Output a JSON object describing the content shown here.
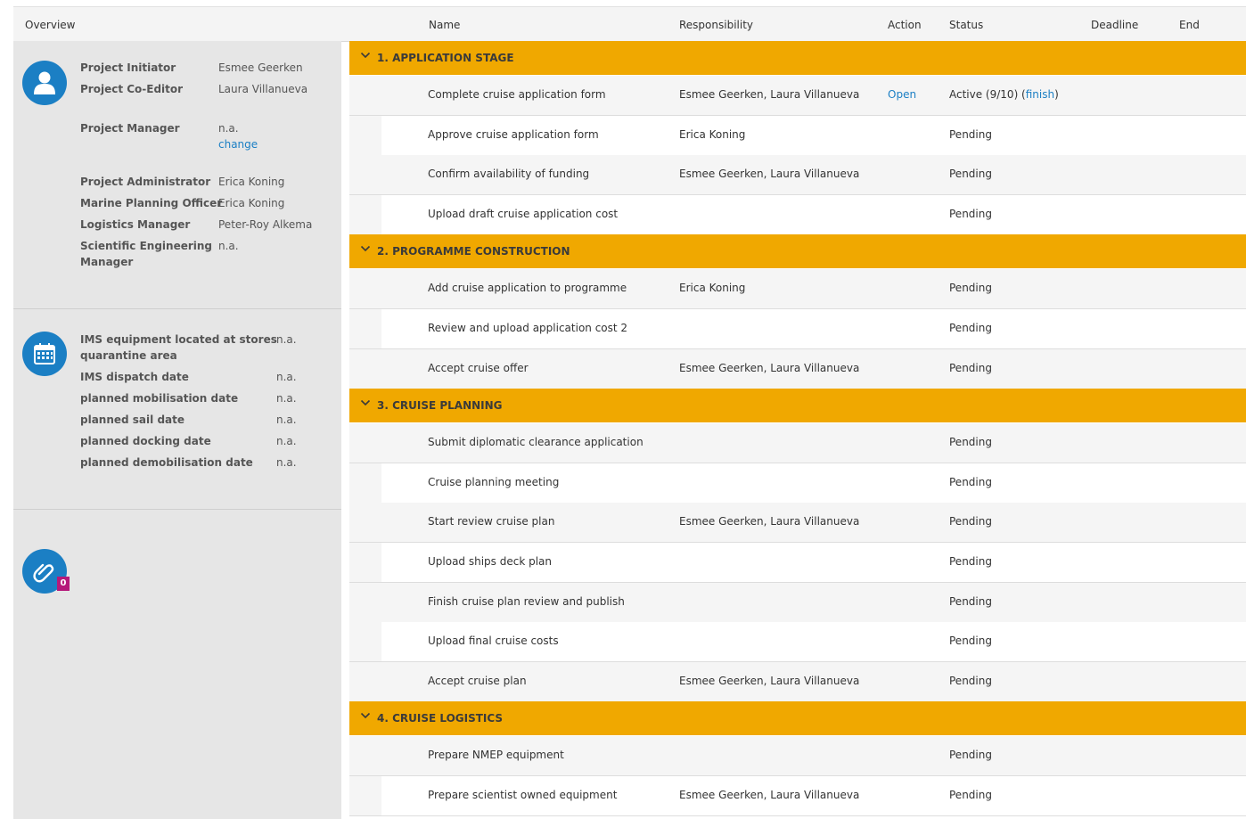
{
  "header": {
    "overview": "Overview",
    "columns": {
      "name": "Name",
      "responsibility": "Responsibility",
      "action": "Action",
      "status": "Status",
      "deadline": "Deadline",
      "end": "End"
    }
  },
  "roles": [
    {
      "label": "Project Initiator",
      "value": "Esmee Geerken"
    },
    {
      "label": "Project Co-Editor",
      "value": "Laura Villanueva"
    },
    {
      "label": "Project Manager",
      "value": "n.a.",
      "link": "change"
    },
    {
      "label": "Project Administrator",
      "value": "Erica Koning"
    },
    {
      "label": "Marine Planning Officer",
      "value": "Erica Koning"
    },
    {
      "label": "Logistics Manager",
      "value": "Peter-Roy Alkema"
    },
    {
      "label": "Scientific Engineering",
      "label2": "Manager",
      "value": "n.a."
    }
  ],
  "dates": [
    {
      "label": "IMS equipment located at stores",
      "label2": "quarantine area",
      "value": "n.a."
    },
    {
      "label": "IMS dispatch date",
      "value": "n.a."
    },
    {
      "label": "planned mobilisation date",
      "value": "n.a."
    },
    {
      "label": "planned sail date",
      "value": "n.a."
    },
    {
      "label": "planned docking date",
      "value": "n.a."
    },
    {
      "label": "planned demobilisation date",
      "value": "n.a."
    }
  ],
  "attachments": {
    "count": "0"
  },
  "icons": {
    "user": "user-icon",
    "calendar": "calendar-icon",
    "attachment": "paperclip-icon",
    "collapse": "chevron-down-icon"
  },
  "colors": {
    "accent": "#1b7fc4",
    "group": "#f0a800",
    "badge": "#b5197a"
  },
  "groups": [
    {
      "title": "1. APPLICATION STAGE",
      "tasks": [
        {
          "name": "Complete cruise application form",
          "resp": "Esmee Geerken, Laura Villanueva",
          "action": "Open",
          "status": "Active (9/10) (",
          "status_link": "finish",
          "status_end": ")"
        },
        {
          "name": "Approve cruise application form",
          "resp": "Erica Koning",
          "status": "Pending"
        },
        {
          "name": "Confirm availability of funding",
          "resp": "Esmee Geerken, Laura Villanueva",
          "status": "Pending"
        },
        {
          "name": "Upload draft cruise application cost",
          "resp": "",
          "status": "Pending"
        }
      ]
    },
    {
      "title": "2. PROGRAMME CONSTRUCTION",
      "tasks": [
        {
          "name": "Add cruise application to programme",
          "resp": "Erica Koning",
          "status": "Pending"
        },
        {
          "name": "Review and upload application cost 2",
          "resp": "",
          "status": "Pending"
        },
        {
          "name": "Accept cruise offer",
          "resp": "Esmee Geerken, Laura Villanueva",
          "status": "Pending"
        }
      ]
    },
    {
      "title": "3. CRUISE PLANNING",
      "tasks": [
        {
          "name": "Submit diplomatic clearance application",
          "resp": "",
          "status": "Pending"
        },
        {
          "name": "Cruise planning meeting",
          "resp": "",
          "status": "Pending"
        },
        {
          "name": "Start review cruise plan",
          "resp": "Esmee Geerken, Laura Villanueva",
          "status": "Pending"
        },
        {
          "name": "Upload ships deck plan",
          "resp": "",
          "status": "Pending"
        },
        {
          "name": "Finish cruise plan review and publish",
          "resp": "",
          "status": "Pending"
        },
        {
          "name": "Upload final cruise costs",
          "resp": "",
          "status": "Pending"
        },
        {
          "name": "Accept cruise plan",
          "resp": "Esmee Geerken, Laura Villanueva",
          "status": "Pending"
        }
      ]
    },
    {
      "title": "4. CRUISE LOGISTICS",
      "tasks": [
        {
          "name": "Prepare NMEP equipment",
          "resp": "",
          "status": "Pending"
        },
        {
          "name": "Prepare scientist owned equipment",
          "resp": "Esmee Geerken, Laura Villanueva",
          "status": "Pending"
        }
      ]
    }
  ]
}
